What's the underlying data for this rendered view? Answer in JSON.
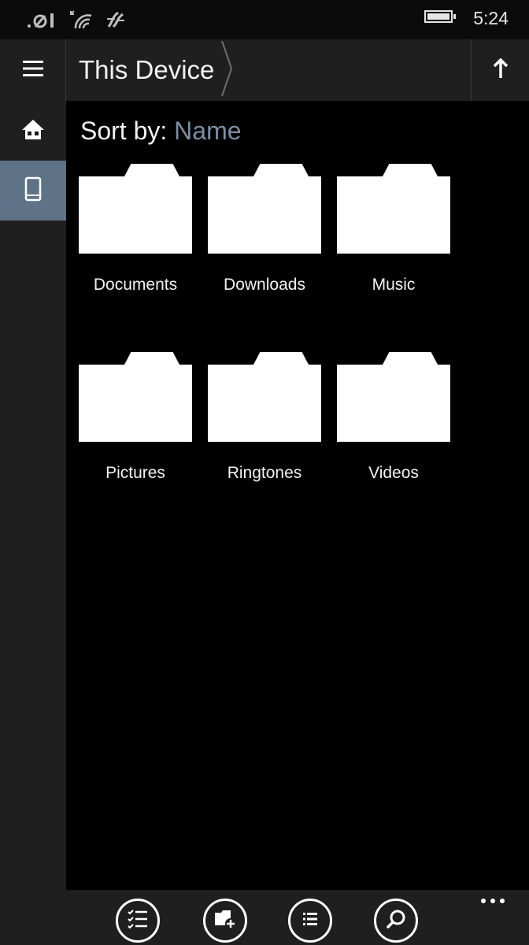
{
  "status_bar": {
    "clock": "5:24",
    "icons": [
      "signal-icon",
      "wifi-icon",
      "data-sense-icon",
      "battery-icon"
    ]
  },
  "header": {
    "menu_icon": "hamburger-icon",
    "title": "This Device",
    "up_icon": "up-arrow-icon"
  },
  "side_nav": {
    "items": [
      {
        "icon": "home-icon",
        "active": false
      },
      {
        "icon": "phone-device-icon",
        "active": true
      }
    ]
  },
  "main": {
    "sort_label": "Sort by:",
    "sort_value": "Name",
    "folders": [
      {
        "label": "Documents"
      },
      {
        "label": "Downloads"
      },
      {
        "label": "Music"
      },
      {
        "label": "Pictures"
      },
      {
        "label": "Ringtones"
      },
      {
        "label": "Videos"
      }
    ]
  },
  "app_bar": {
    "buttons": [
      "select-icon",
      "new-folder-icon",
      "list-view-icon",
      "search-icon"
    ],
    "more_icon": "more-icon"
  },
  "colors": {
    "accent": "#5f7388",
    "sort_value": "#7d8fa3",
    "panel": "#1f1f1f",
    "background": "#000000"
  }
}
